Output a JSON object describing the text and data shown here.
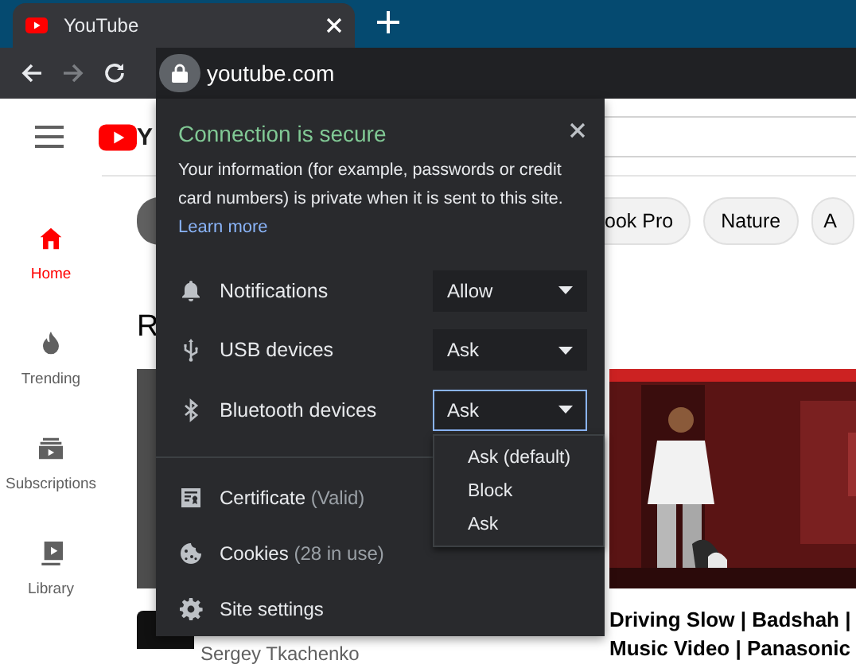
{
  "browser": {
    "tab": {
      "title": "YouTube",
      "selected": true
    },
    "forward_disabled": true,
    "address": "youtube.com"
  },
  "youtube": {
    "logo_text": "Y",
    "sidebar": [
      {
        "kind": "home",
        "label": "Home",
        "selected": true
      },
      {
        "kind": "trending",
        "label": "Trending",
        "selected": false
      },
      {
        "kind": "subscriptions",
        "label": "Subscriptions",
        "selected": false
      },
      {
        "kind": "library",
        "label": "Library",
        "selected": false
      }
    ],
    "chips": [
      {
        "selected": true
      },
      {
        "label": "ook Pro",
        "selected": false
      },
      {
        "label": "Nature",
        "selected": false
      },
      {
        "label": "A",
        "selected": false
      }
    ],
    "section_heading": "R",
    "videos": [
      {
        "kind": "plain",
        "channel": "Sergey Tkachenko"
      },
      {
        "kind": "picture",
        "title_lines": [
          "Driving Slow | Badshah |",
          "Music Video | Panasonic"
        ]
      }
    ]
  },
  "site_info": {
    "title": "Connection is secure",
    "body": "Your information (for example, passwords or credit card numbers) is private when it is sent to this site.",
    "link": "Learn more",
    "permissions": [
      {
        "kind": "notifications",
        "label": "Notifications",
        "value": "Allow",
        "open": false
      },
      {
        "kind": "usb",
        "label": "USB devices",
        "value": "Ask",
        "open": false
      },
      {
        "kind": "bluetooth",
        "label": "Bluetooth devices",
        "value": "Ask",
        "open": true
      }
    ],
    "menu_options": [
      "Ask (default)",
      "Block",
      "Ask"
    ],
    "items": [
      {
        "kind": "certificate",
        "label": "Certificate",
        "detail": "(Valid)"
      },
      {
        "kind": "cookies",
        "label": "Cookies",
        "detail": "(28 in use)"
      },
      {
        "kind": "settings",
        "label": "Site settings"
      }
    ]
  }
}
